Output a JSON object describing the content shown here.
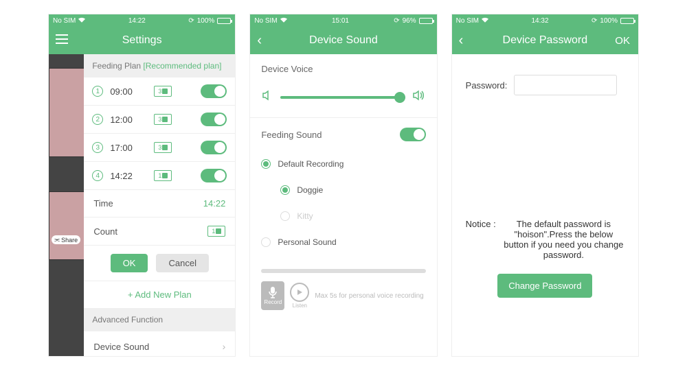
{
  "screen1": {
    "status": {
      "carrier": "No SIM",
      "time": "14:22",
      "battery": "100%"
    },
    "title": "Settings",
    "feedingPlan": {
      "label": "Feeding Plan",
      "rec": "[Recommended plan]",
      "rows": [
        {
          "n": "1",
          "time": "09:00",
          "portion": "3"
        },
        {
          "n": "2",
          "time": "12:00",
          "portion": "3"
        },
        {
          "n": "3",
          "time": "17:00",
          "portion": "3"
        },
        {
          "n": "4",
          "time": "14:22",
          "portion": "1"
        }
      ],
      "timeLabel": "Time",
      "timeValue": "14:22",
      "countLabel": "Count",
      "countValue": "1",
      "ok": "OK",
      "cancel": "Cancel",
      "add": "+ Add New Plan",
      "advanced": "Advanced Function",
      "deviceSound": "Device Sound"
    },
    "underlay": {
      "share": "Share"
    }
  },
  "screen2": {
    "status": {
      "carrier": "No SIM",
      "time": "15:01",
      "battery": "96%"
    },
    "title": "Device Sound",
    "deviceVoice": "Device Voice",
    "feedingSound": "Feeding Sound",
    "defaultRecording": "Default Recording",
    "doggie": "Doggie",
    "kitty": "Kitty",
    "personalSound": "Personal Sound",
    "record": "Record",
    "listen": "Listen",
    "hint": "Max 5s for personal voice recording"
  },
  "screen3": {
    "status": {
      "carrier": "No SIM",
      "time": "14:32",
      "battery": "100%"
    },
    "title": "Device Password",
    "ok": "OK",
    "passwordLabel": "Password:",
    "noticeLabel": "Notice :",
    "noticeText": "The default password is \"hoison\".Press the below button if you need you change password.",
    "changeBtn": "Change Password"
  }
}
